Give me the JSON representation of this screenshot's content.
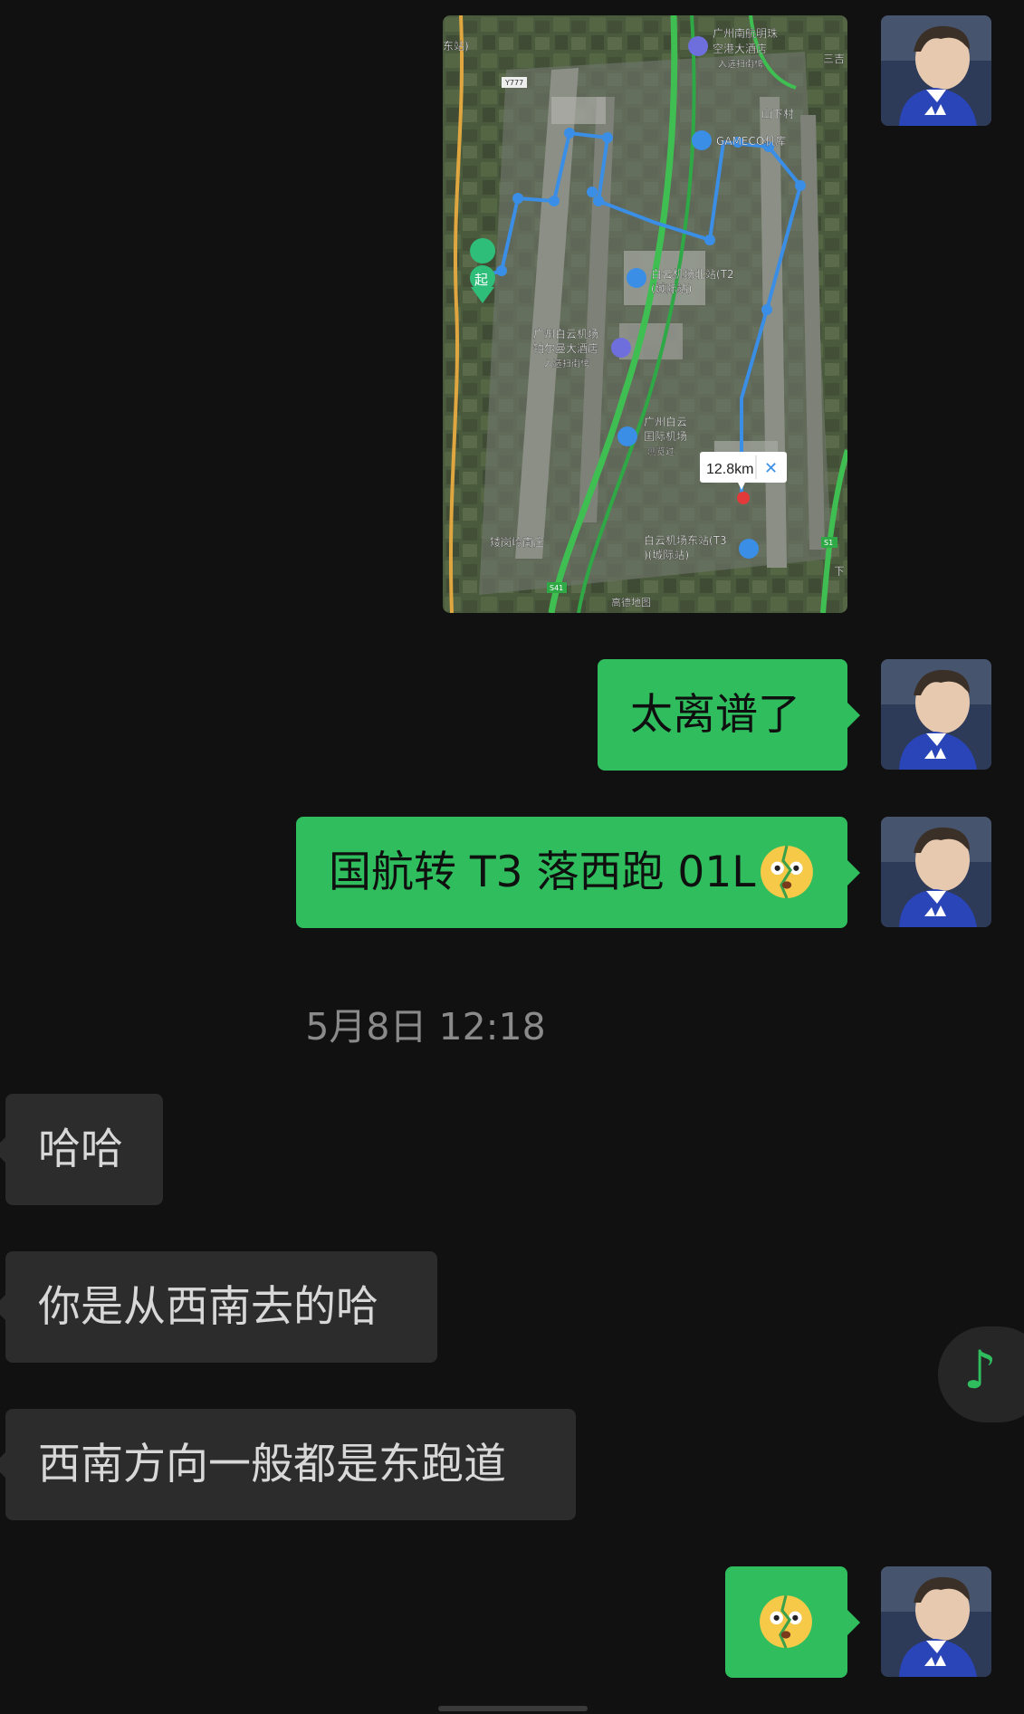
{
  "map": {
    "start_label": "起",
    "distance": "12.8km",
    "close": "✕",
    "labels": {
      "hotel1": "广州南航明珠",
      "hotel1b": "空港大酒店",
      "hotel1c": "入选扫街榜",
      "village": "山下村",
      "hangar": "GAMECO机库",
      "station_north": "白云机场北站(T2",
      "station_north2": "(城际站)",
      "hotel2": "广州白云机场",
      "hotel2b": "铂尔曼大酒店",
      "hotel2c": "入选扫街榜",
      "airport": "广州白云",
      "airport2": "国际机场",
      "airport3": "测览过",
      "station_east": "白云机场东站(T3",
      "station_east2": ")(城际站)",
      "southwest_village": "矮岗岭南庄",
      "edge_left": "东站)",
      "edge_right": "三吉",
      "edge_right2": "下",
      "road1": "S41",
      "road2": "S1",
      "road3": "Y777",
      "watermark": "高德地图"
    }
  },
  "messages": {
    "m1": "太离谱了",
    "m2": "国航转 T3 落西跑 01L",
    "timestamp": "5月8日 12:18",
    "m3": "哈哈",
    "m4": "你是从西南去的哈",
    "m5": "西南方向一般都是东跑道"
  },
  "colors": {
    "outgoing_bubble": "#2fbd5e",
    "incoming_bubble": "#2c2c2c",
    "background": "#111111",
    "route": "#3a8ee6"
  },
  "icons": {
    "music": "music-note-icon",
    "emoji": "hurt-face-emoji"
  }
}
